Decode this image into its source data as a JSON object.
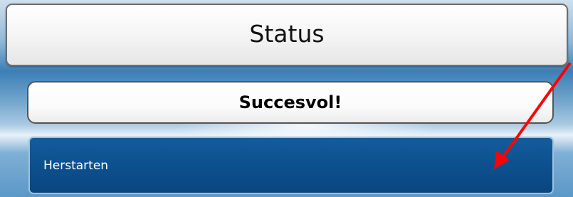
{
  "header": {
    "title": "Status"
  },
  "message": {
    "text": "Succesvol!"
  },
  "actions": {
    "restart_label": "Herstarten"
  },
  "annotation": {
    "arrow_color": "#ff0000",
    "arrow_icon": "red-arrow"
  },
  "colors": {
    "button_blue": "#0c4f8d",
    "header_bg": "#f2f2f2",
    "background_blue": "#3c7fb6"
  }
}
